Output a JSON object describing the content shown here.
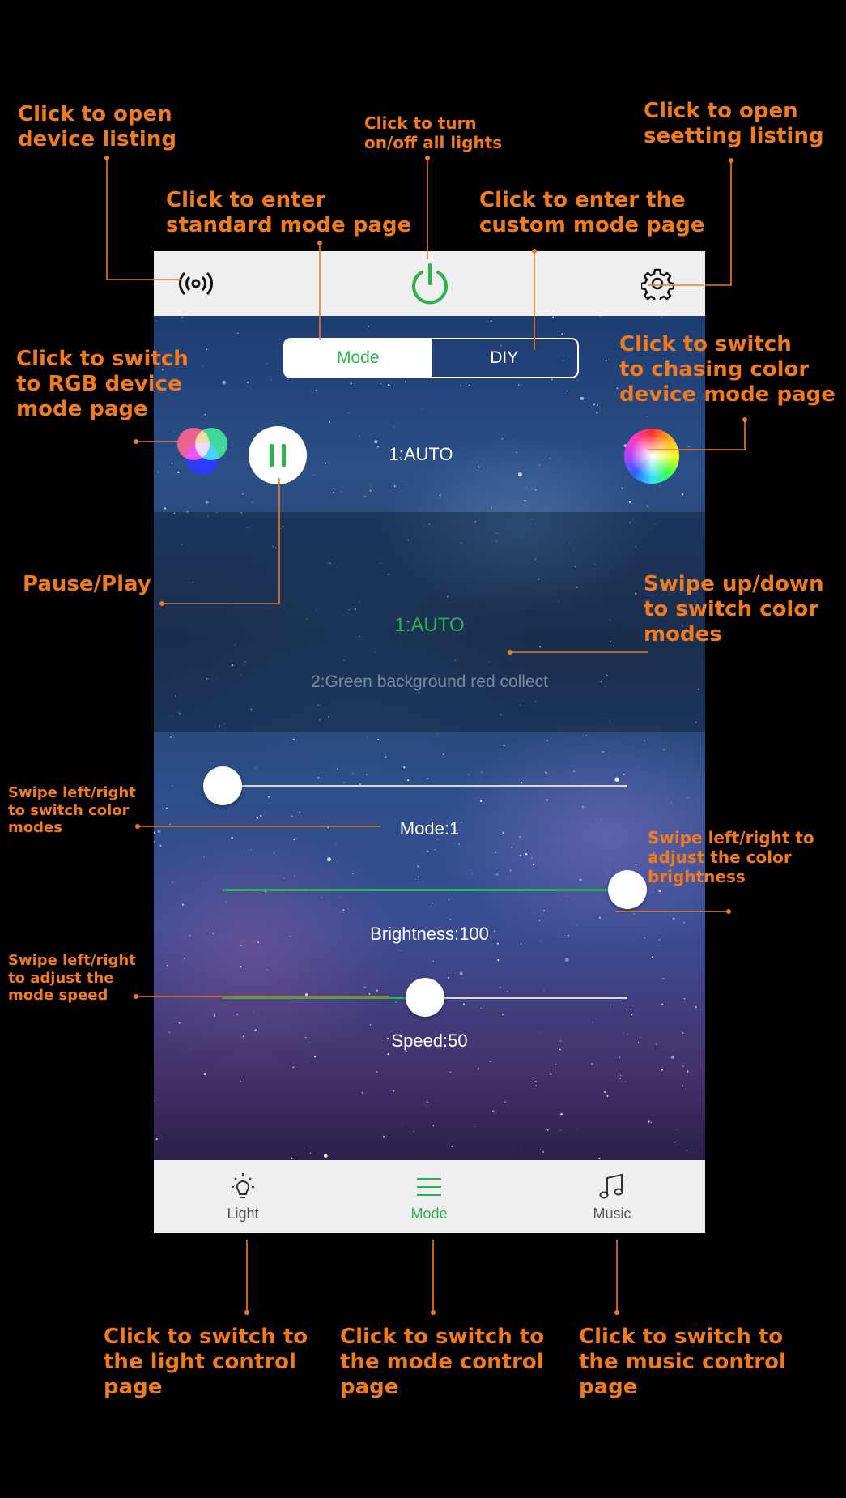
{
  "topbar": {
    "device_icon": "wireless-signal-icon",
    "power_icon": "power-icon",
    "settings_icon": "gear-icon",
    "power_color": "#2ab44a"
  },
  "segment": {
    "mode_label": "Mode",
    "diy_label": "DIY"
  },
  "mode_row": {
    "rgb_icon": "rgb-circles-icon",
    "pause_icon": "pause-icon",
    "current": "1:AUTO",
    "wheel_icon": "color-wheel-icon"
  },
  "mode_list": {
    "selected": "1:AUTO",
    "next": "2:Green background red collect"
  },
  "sliders": {
    "mode": {
      "label": "Mode:1",
      "value": 1
    },
    "brightness": {
      "label": "Brightness:100",
      "value": 100
    },
    "speed": {
      "label": "Speed:50",
      "value": 50
    }
  },
  "bottom_nav": [
    {
      "label": "Light",
      "icon": "bulb-icon",
      "active": false
    },
    {
      "label": "Mode",
      "icon": "menu-lines-icon",
      "active": true
    },
    {
      "label": "Music",
      "icon": "music-note-icon",
      "active": false
    }
  ],
  "annotations": {
    "device_listing": "Click to open\ndevice listing",
    "power": "Click to turn\non/off all lights",
    "settings": "Click to open\nseetting listing",
    "standard_mode": "Click to enter\nstandard mode page",
    "custom_mode": "Click to enter the\ncustom mode page",
    "rgb_device": "Click to switch\nto RGB device\nmode page",
    "chasing_device": "Click to switch\nto chasing color\ndevice mode page",
    "pause_play": "Pause/Play",
    "swipe_updown": "Swipe up/down\nto switch color\nmodes",
    "swipe_mode": "Swipe left/right\nto switch color\nmodes",
    "swipe_brightness": "Swipe left/right to\nadjust the color\nbrightness",
    "swipe_speed": "Swipe left/right\nto adjust the\nmode speed",
    "nav_light": "Click to switch to\nthe light control\npage",
    "nav_mode": "Click to switch to\nthe mode control\npage",
    "nav_music": "Click to switch to\nthe music control\npage"
  },
  "colors": {
    "accent_green": "#2ab44a",
    "annotation_orange": "#f07a1e"
  }
}
